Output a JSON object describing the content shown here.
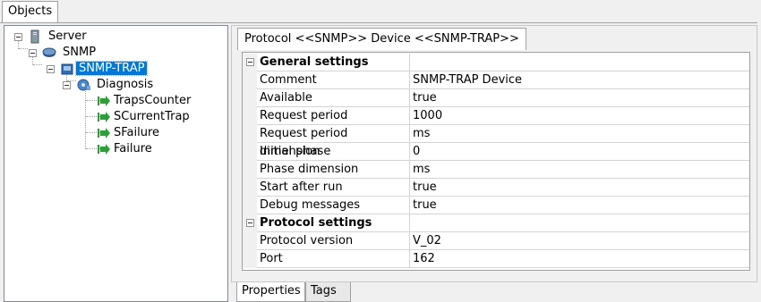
{
  "top_tab": {
    "label": "Objects"
  },
  "tree": {
    "server": "Server",
    "snmp": "SNMP",
    "snmp_trap": "SNMP-TRAP",
    "diagnosis": "Diagnosis",
    "items": [
      "TrapsCounter",
      "SCurrentTrap",
      "SFailure",
      "Failure"
    ]
  },
  "device_tab": {
    "label": "Protocol <<SNMP>> Device <<SNMP-TRAP>>"
  },
  "grid": {
    "general": {
      "title": "General settings",
      "rows": [
        {
          "name": "Comment",
          "value": "SNMP-TRAP Device"
        },
        {
          "name": "Available",
          "value": "true"
        },
        {
          "name": "Request period",
          "value": "1000"
        },
        {
          "name": "Request period dimension",
          "value": "ms"
        },
        {
          "name": "Initial phase",
          "value": "0"
        },
        {
          "name": "Phase dimension",
          "value": "ms"
        },
        {
          "name": "Start after run",
          "value": "true"
        },
        {
          "name": "Debug messages",
          "value": "true"
        }
      ]
    },
    "protocol": {
      "title": "Protocol settings",
      "rows": [
        {
          "name": "Protocol version",
          "value": "V_02"
        },
        {
          "name": "Port",
          "value": "162"
        }
      ]
    }
  },
  "bottom_tabs": {
    "properties": "Properties",
    "tags": "Tags"
  },
  "colors": {
    "selection": "#0078d7",
    "green_arrow": "#2e9e3a"
  }
}
